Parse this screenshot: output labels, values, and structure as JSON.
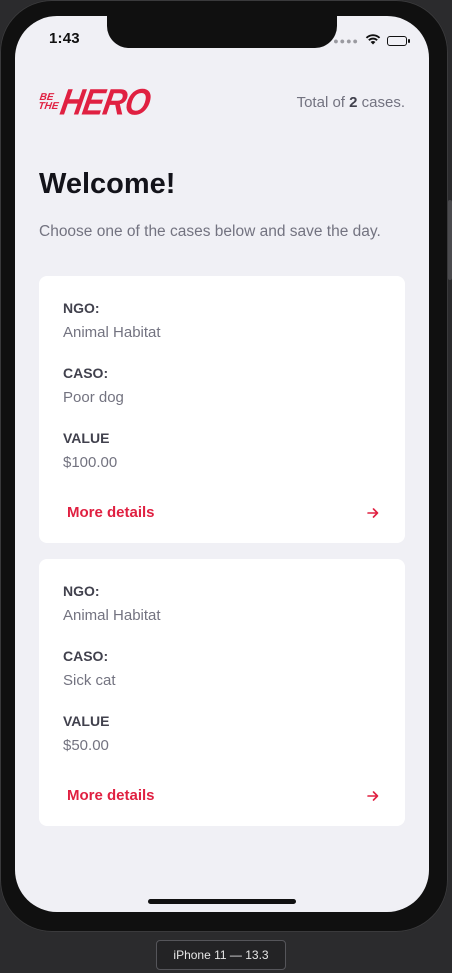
{
  "status_bar": {
    "time": "1:43"
  },
  "header": {
    "logo_small_top": "BE",
    "logo_small_bottom": "THE",
    "logo_big": "HERO",
    "total_prefix": "Total of ",
    "total_count": "2",
    "total_suffix": " cases."
  },
  "main": {
    "title": "Welcome!",
    "description": "Choose one of the cases below and save the day."
  },
  "incidents": [
    {
      "ngo_label": "NGO:",
      "ngo_value": "Animal Habitat",
      "case_label": "CASO:",
      "case_value": "Poor dog",
      "value_label": "VALUE",
      "value_value": "$100.00",
      "details_label": "More details"
    },
    {
      "ngo_label": "NGO:",
      "ngo_value": "Animal Habitat",
      "case_label": "CASO:",
      "case_value": "Sick cat",
      "value_label": "VALUE",
      "value_value": "$50.00",
      "details_label": "More details"
    }
  ],
  "device": {
    "label": "iPhone 11 — 13.3"
  },
  "icons": {
    "arrow": "arrow-right-icon",
    "wifi": "wifi-icon",
    "battery": "battery-icon"
  },
  "colors": {
    "accent": "#e02041",
    "background": "#f0f0f5",
    "card": "#ffffff",
    "title": "#13131a",
    "label": "#41414d",
    "muted": "#737380"
  }
}
